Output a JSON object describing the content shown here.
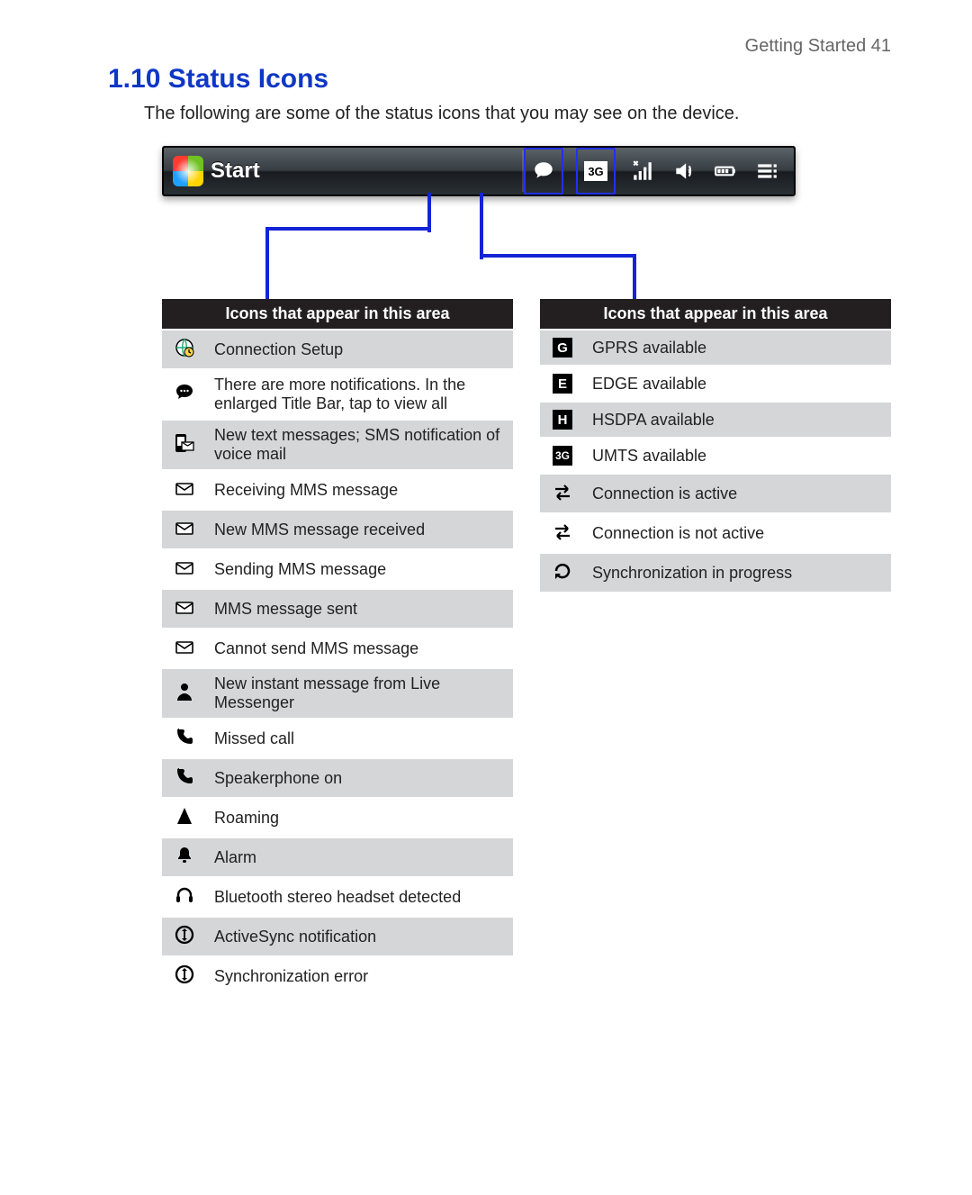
{
  "page": {
    "running_head": "Getting Started  41",
    "heading": "1.10  Status Icons",
    "intro": "The following are some of the status icons that you may see on the device."
  },
  "titlebar": {
    "start_label": "Start",
    "icons": [
      "notification-icon",
      "3g-icon",
      "signal-icon",
      "volume-icon",
      "battery-icon",
      "menu-icon"
    ]
  },
  "tables": {
    "left_header": "Icons that appear in this area",
    "right_header": "Icons that appear in this area"
  },
  "left": [
    {
      "icon": "globe-clock-icon",
      "label": "Connection Setup"
    },
    {
      "icon": "speech-bubble-icon",
      "label": "There are more notifications. In the enlarged Title Bar, tap to view all"
    },
    {
      "icon": "sms-phone-icon",
      "label": "New text messages; SMS notification of voice mail"
    },
    {
      "icon": "mms-in-icon",
      "label": "Receiving MMS message"
    },
    {
      "icon": "mms-new-icon",
      "label": "New MMS message received"
    },
    {
      "icon": "mms-out-icon",
      "label": "Sending MMS message"
    },
    {
      "icon": "mms-sent-icon",
      "label": "MMS message sent"
    },
    {
      "icon": "mms-fail-icon",
      "label": "Cannot send MMS message"
    },
    {
      "icon": "messenger-icon",
      "label": "New instant message from Live Messenger"
    },
    {
      "icon": "missed-call-icon",
      "label": "Missed call"
    },
    {
      "icon": "speakerphone-icon",
      "label": "Speakerphone on"
    },
    {
      "icon": "roaming-icon",
      "label": "Roaming"
    },
    {
      "icon": "alarm-icon",
      "label": "Alarm"
    },
    {
      "icon": "bt-headset-icon",
      "label": "Bluetooth stereo headset detected"
    },
    {
      "icon": "activesync-icon",
      "label": "ActiveSync notification"
    },
    {
      "icon": "sync-error-icon",
      "label": "Synchronization error"
    }
  ],
  "right": [
    {
      "icon": "gprs-icon",
      "glyph": "G",
      "label": "GPRS available"
    },
    {
      "icon": "edge-icon",
      "glyph": "E",
      "label": "EDGE available"
    },
    {
      "icon": "hsdpa-icon",
      "glyph": "H",
      "label": "HSDPA available"
    },
    {
      "icon": "umts-icon",
      "glyph": "3G",
      "label": "UMTS available"
    },
    {
      "icon": "conn-active-icon",
      "label": "Connection is active"
    },
    {
      "icon": "conn-inactive-icon",
      "label": "Connection is not active"
    },
    {
      "icon": "sync-progress-icon",
      "label": "Synchronization in progress"
    }
  ]
}
